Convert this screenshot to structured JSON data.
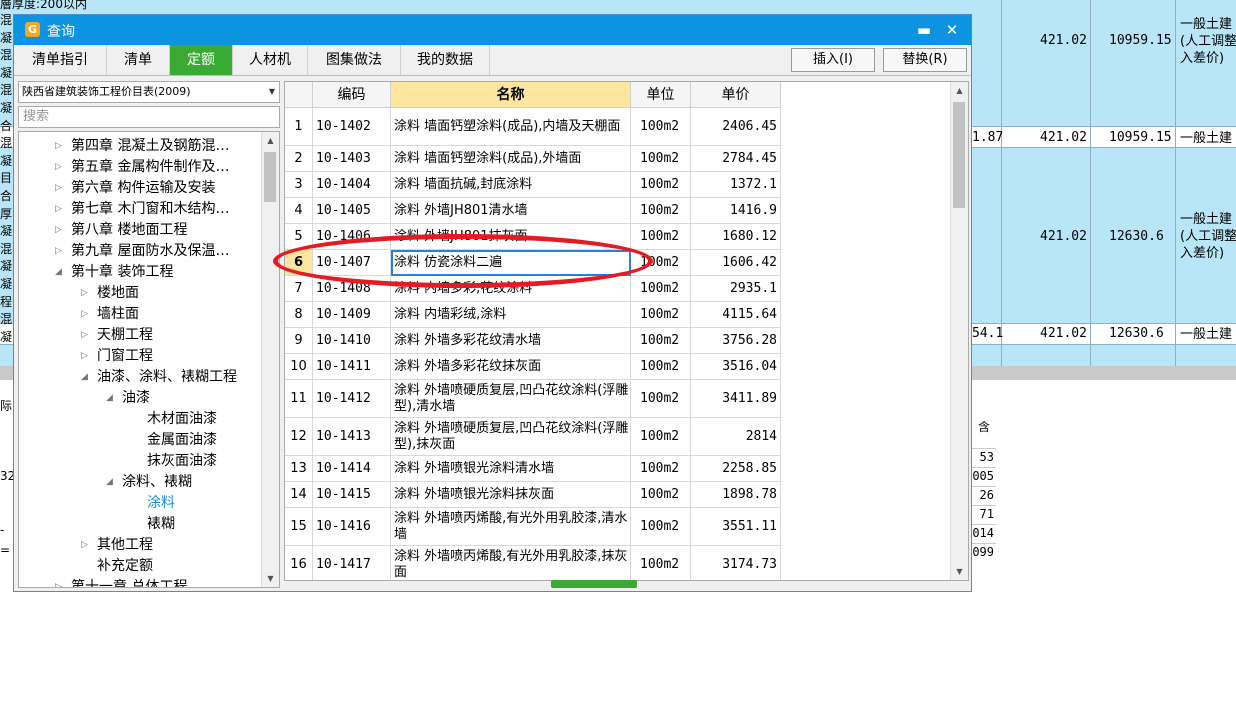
{
  "background": {
    "top_left_text": "層厚度:200以内",
    "left_fragments": [
      "混",
      "凝",
      "混",
      "凝",
      "混",
      "凝",
      "合",
      "混",
      "凝",
      "目",
      "合",
      "厚",
      "凝",
      "混",
      "凝",
      "凝",
      "程",
      "混",
      "凝"
    ],
    "row_values": [
      {
        "mid": "",
        "price": "421.02",
        "total": "10959.15",
        "desc": "一般土建\n(人工调整\n入差价)"
      },
      {
        "mid": "1.87",
        "price": "421.02",
        "total": "10959.15",
        "desc": "一般土建"
      },
      {
        "mid": "",
        "price": "421.02",
        "total": "12630.6",
        "desc": "一般土建\n(人工调整\n入差价)"
      },
      {
        "mid": "54.1",
        "price": "421.02",
        "total": "12630.6",
        "desc": "一般土建"
      }
    ],
    "lower_left": [
      "际",
      "32",
      "-",
      "="
    ],
    "lower_header": "含",
    "lower_values": [
      "53",
      "005",
      "26",
      "71",
      "014",
      "099"
    ]
  },
  "dialog": {
    "title": "查询",
    "app_icon": "G",
    "maximize_icon": "▬",
    "close_icon": "✕",
    "tabs": [
      {
        "label": "清单指引",
        "active": false
      },
      {
        "label": "清单",
        "active": false
      },
      {
        "label": "定额",
        "active": true
      },
      {
        "label": "人材机",
        "active": false
      },
      {
        "label": "图集做法",
        "active": false
      },
      {
        "label": "我的数据",
        "active": false
      }
    ],
    "insert_button": "插入(I)",
    "replace_button": "替换(R)"
  },
  "library": {
    "selected": "陕西省建筑装饰工程价目表(2009)",
    "search_placeholder": "搜索"
  },
  "tree": [
    {
      "label": "第四章  混凝土及钢筋混…",
      "toggle": "▷",
      "level": 0
    },
    {
      "label": "第五章  金属构件制作及…",
      "toggle": "▷",
      "level": 0
    },
    {
      "label": "第六章  构件运输及安装",
      "toggle": "▷",
      "level": 0
    },
    {
      "label": "第七章  木门窗和木结构…",
      "toggle": "▷",
      "level": 0
    },
    {
      "label": "第八章  楼地面工程",
      "toggle": "▷",
      "level": 0
    },
    {
      "label": "第九章  屋面防水及保温…",
      "toggle": "▷",
      "level": 0
    },
    {
      "label": "第十章  装饰工程",
      "toggle": "◢",
      "level": 0
    },
    {
      "label": "楼地面",
      "toggle": "▷",
      "level": 1
    },
    {
      "label": "墙柱面",
      "toggle": "▷",
      "level": 1
    },
    {
      "label": "天棚工程",
      "toggle": "▷",
      "level": 1
    },
    {
      "label": "门窗工程",
      "toggle": "▷",
      "level": 1
    },
    {
      "label": "油漆、涂料、裱糊工程",
      "toggle": "◢",
      "level": 1
    },
    {
      "label": "油漆",
      "toggle": "◢",
      "level": 2
    },
    {
      "label": "木材面油漆",
      "toggle": "",
      "level": 3
    },
    {
      "label": "金属面油漆",
      "toggle": "",
      "level": 3
    },
    {
      "label": "抹灰面油漆",
      "toggle": "",
      "level": 3
    },
    {
      "label": "涂料、裱糊",
      "toggle": "◢",
      "level": 2
    },
    {
      "label": "涂料",
      "toggle": "",
      "level": 3,
      "selected": true
    },
    {
      "label": "裱糊",
      "toggle": "",
      "level": 3
    },
    {
      "label": "其他工程",
      "toggle": "▷",
      "level": 1
    },
    {
      "label": "补充定额",
      "toggle": "",
      "level": 1
    },
    {
      "label": "第十一章  总体工程",
      "toggle": "▷",
      "level": 0
    }
  ],
  "grid": {
    "columns": [
      "",
      "编码",
      "名称",
      "单位",
      "单价"
    ],
    "current_row": 6,
    "rows": [
      {
        "no": "1",
        "code": "10-1402",
        "name": "涂料  墙面钙塑涂料(成品),内墙及天棚面",
        "unit": "100m2",
        "price": "2406.45"
      },
      {
        "no": "2",
        "code": "10-1403",
        "name": "涂料  墙面钙塑涂料(成品),外墙面",
        "unit": "100m2",
        "price": "2784.45"
      },
      {
        "no": "3",
        "code": "10-1404",
        "name": "涂料  墙面抗碱,封底涂料",
        "unit": "100m2",
        "price": "1372.1"
      },
      {
        "no": "4",
        "code": "10-1405",
        "name": "涂料  外墙JH801清水墙",
        "unit": "100m2",
        "price": "1416.9"
      },
      {
        "no": "5",
        "code": "10-1406",
        "name": "涂料  外墙JH801抹灰面",
        "unit": "100m2",
        "price": "1680.12"
      },
      {
        "no": "6",
        "code": "10-1407",
        "name": "涂料  仿瓷涂料二遍",
        "unit": "100m2",
        "price": "1606.42"
      },
      {
        "no": "7",
        "code": "10-1408",
        "name": "涂料  内墙多彩,花纹涂料",
        "unit": "100m2",
        "price": "2935.1"
      },
      {
        "no": "8",
        "code": "10-1409",
        "name": "涂料  内墙彩绒,涂料",
        "unit": "100m2",
        "price": "4115.64"
      },
      {
        "no": "9",
        "code": "10-1410",
        "name": "涂料  外墙多彩花纹清水墙",
        "unit": "100m2",
        "price": "3756.28"
      },
      {
        "no": "10",
        "code": "10-1411",
        "name": "涂料  外墙多彩花纹抹灰面",
        "unit": "100m2",
        "price": "3516.04"
      },
      {
        "no": "11",
        "code": "10-1412",
        "name": "涂料  外墙喷硬质复层,凹凸花纹涂料(浮雕型),清水墙",
        "unit": "100m2",
        "price": "3411.89"
      },
      {
        "no": "12",
        "code": "10-1413",
        "name": "涂料  外墙喷硬质复层,凹凸花纹涂料(浮雕型),抹灰面",
        "unit": "100m2",
        "price": "2814"
      },
      {
        "no": "13",
        "code": "10-1414",
        "name": "涂料  外墙喷银光涂料清水墙",
        "unit": "100m2",
        "price": "2258.85"
      },
      {
        "no": "14",
        "code": "10-1415",
        "name": "涂料  外墙喷银光涂料抹灰面",
        "unit": "100m2",
        "price": "1898.78"
      },
      {
        "no": "15",
        "code": "10-1416",
        "name": "涂料  外墙喷丙烯酸,有光外用乳胶漆,清水墙",
        "unit": "100m2",
        "price": "3551.11"
      },
      {
        "no": "16",
        "code": "10-1417",
        "name": "涂料  外墙喷丙烯酸,有光外用乳胶漆,抹灰面",
        "unit": "100m2",
        "price": "3174.73"
      }
    ]
  },
  "colors": {
    "title_bar": "#0d94e0",
    "active_tab": "#3aaa35",
    "header_highlight": "#fde7a0",
    "annotation_oval": "#e51b23",
    "sheet_background": "#b8e6f8"
  }
}
